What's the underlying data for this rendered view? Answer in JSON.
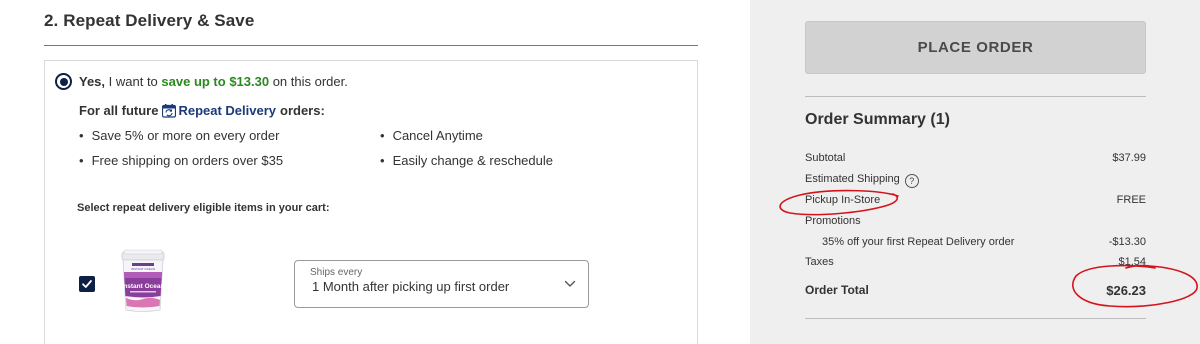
{
  "section": {
    "title": "2. Repeat Delivery & Save"
  },
  "option": {
    "yes_word": "Yes,",
    "yes_text": " I want to ",
    "save_text": "save up to $13.30",
    "order_text": " on this order."
  },
  "future": {
    "prefix": "For all future",
    "brand": "Repeat Delivery",
    "suffix": "orders:"
  },
  "benefits": [
    "Save 5% or more on every order",
    "Free shipping on orders over $35",
    "Cancel Anytime",
    "Easily change & reschedule"
  ],
  "select_label": "Select repeat delivery eligible items in your cart:",
  "product": {
    "brand_text": "INSTANT OCEAN",
    "name_text": "Instant Ocean"
  },
  "ships": {
    "label": "Ships every",
    "value": "1 Month after picking up first order"
  },
  "sidebar": {
    "place_order": "PLACE ORDER",
    "summary_title": "Order Summary (1)",
    "subtotal_label": "Subtotal",
    "subtotal_value": "$37.99",
    "shipping_label": "Estimated Shipping",
    "help_glyph": "?",
    "pickup_label": "Pickup In-Store",
    "pickup_value": "FREE",
    "promotions_label": "Promotions",
    "promo_label": "35% off your first Repeat Delivery order",
    "promo_value": "-$13.30",
    "taxes_label": "Taxes",
    "taxes_value": "$1.54",
    "total_label": "Order Total",
    "total_value": "$26.23"
  },
  "colors": {
    "accent_navy": "#0d2146",
    "savings_green": "#2b8a1f",
    "brand_blue": "#1b3a7a",
    "annotation_red": "#d4141c",
    "sidebar_bg": "#efefef",
    "button_bg": "#d2d2d2"
  },
  "icons": {
    "option_radio": "radio-selected",
    "repeat_delivery": "repeat-delivery-icon",
    "item_checkbox": "checkbox-checked",
    "ships_dropdown": "chevron-down-icon",
    "shipping_help": "help-circle-icon"
  }
}
